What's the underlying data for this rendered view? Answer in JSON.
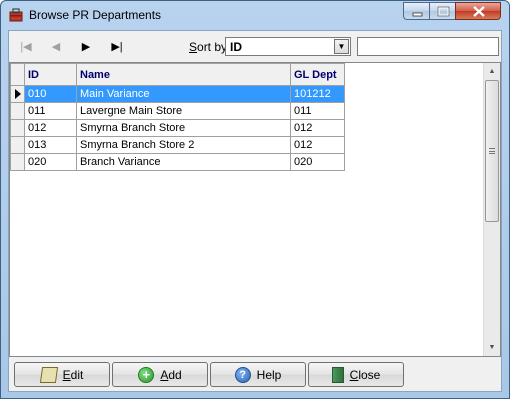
{
  "window": {
    "title": "Browse PR Departments",
    "icon": "app-toolbox-icon"
  },
  "toolbar": {
    "nav": [
      {
        "name": "first-record-button",
        "glyph": "|◀",
        "enabled": false
      },
      {
        "name": "previous-record-button",
        "glyph": "◀",
        "enabled": false
      },
      {
        "name": "next-record-button",
        "glyph": "▶",
        "enabled": true
      },
      {
        "name": "last-record-button",
        "glyph": "▶|",
        "enabled": true
      }
    ],
    "sort_label_accel": "S",
    "sort_label_rest": "ort by",
    "sort_value": "ID",
    "search_value": ""
  },
  "grid": {
    "columns": [
      "ID",
      "Name",
      "GL Dept"
    ],
    "rows": [
      {
        "id": "010",
        "name": "Main Variance",
        "gl": "101212",
        "selected": true
      },
      {
        "id": "011",
        "name": "Lavergne Main Store",
        "gl": "011",
        "selected": false
      },
      {
        "id": "012",
        "name": "Smyrna Branch Store",
        "gl": "012",
        "selected": false
      },
      {
        "id": "013",
        "name": "Smyrna Branch Store 2",
        "gl": "012",
        "selected": false
      },
      {
        "id": "020",
        "name": "Branch Variance",
        "gl": "020",
        "selected": false
      }
    ]
  },
  "buttons": {
    "edit": {
      "accel": "E",
      "rest": "dit",
      "icon": "edit-icon"
    },
    "add": {
      "accel": "A",
      "rest": "dd",
      "icon": "add-icon"
    },
    "help": {
      "label": "Help",
      "icon": "help-icon"
    },
    "close": {
      "accel": "C",
      "rest": "lose",
      "icon": "door-close-icon"
    }
  },
  "colors": {
    "selection": "#3399ff",
    "header_text": "#00006e"
  }
}
